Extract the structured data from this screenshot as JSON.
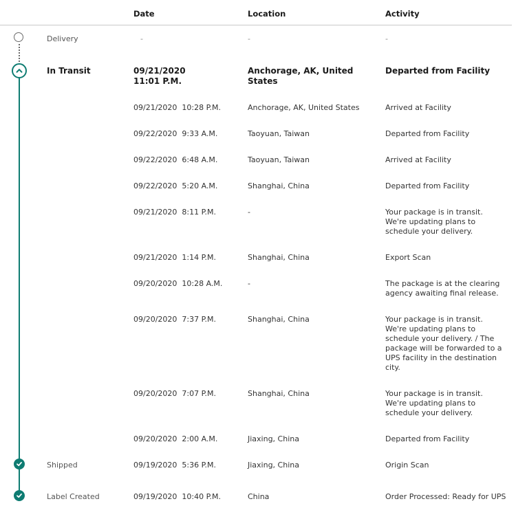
{
  "headers": {
    "date": "Date",
    "location": "Location",
    "activity": "Activity"
  },
  "delivery": {
    "status": "Delivery",
    "date": "-",
    "location": "-",
    "activity": "-"
  },
  "in_transit": {
    "status": "In Transit",
    "date": "09/21/2020\n11:01 P.M.",
    "location": "Anchorage, AK, United\nStates",
    "activity": "Departed from Facility"
  },
  "events": [
    {
      "date": "09/21/2020  10:28 P.M.",
      "location": "Anchorage, AK, United States",
      "activity": "Arrived at Facility"
    },
    {
      "date": "09/22/2020  9:33 A.M.",
      "location": "Taoyuan, Taiwan",
      "activity": "Departed from Facility"
    },
    {
      "date": "09/22/2020  6:48 A.M.",
      "location": "Taoyuan, Taiwan",
      "activity": "Arrived at Facility"
    },
    {
      "date": "09/22/2020  5:20 A.M.",
      "location": "Shanghai, China",
      "activity": "Departed from Facility"
    },
    {
      "date": "09/21/2020  8:11 P.M.",
      "location": "-",
      "activity": "Your package is in transit.\nWe're updating plans to\nschedule your delivery."
    },
    {
      "date": "09/21/2020  1:14 P.M.",
      "location": "Shanghai, China",
      "activity": "Export Scan"
    },
    {
      "date": "09/20/2020  10:28 A.M.",
      "location": "-",
      "activity": "The package is at the clearing\nagency awaiting final release."
    },
    {
      "date": "09/20/2020  7:37 P.M.",
      "location": "Shanghai, China",
      "activity": "Your package is in transit.\nWe're updating plans to\nschedule your delivery. / The\npackage will be forwarded to a\nUPS facility in the destination\ncity."
    },
    {
      "date": "09/20/2020  7:07 P.M.",
      "location": "Shanghai, China",
      "activity": "Your package is in transit.\nWe're updating plans to\nschedule your delivery."
    },
    {
      "date": "09/20/2020  2:00 A.M.",
      "location": "Jiaxing, China",
      "activity": "Departed from Facility"
    }
  ],
  "shipped": {
    "status": "Shipped",
    "date": "09/19/2020  5:36 P.M.",
    "location": "Jiaxing, China",
    "activity": "Origin Scan"
  },
  "label_created": {
    "status": "Label Created",
    "date": "09/19/2020  10:40 P.M.",
    "location": "China",
    "activity": "Order Processed: Ready for UPS"
  },
  "colors": {
    "accent": "#0e7c72",
    "pending": "#6b6b6b"
  },
  "icons": {
    "expand": "chevron-up-icon",
    "done": "check-icon",
    "pending": "empty-circle-icon"
  }
}
